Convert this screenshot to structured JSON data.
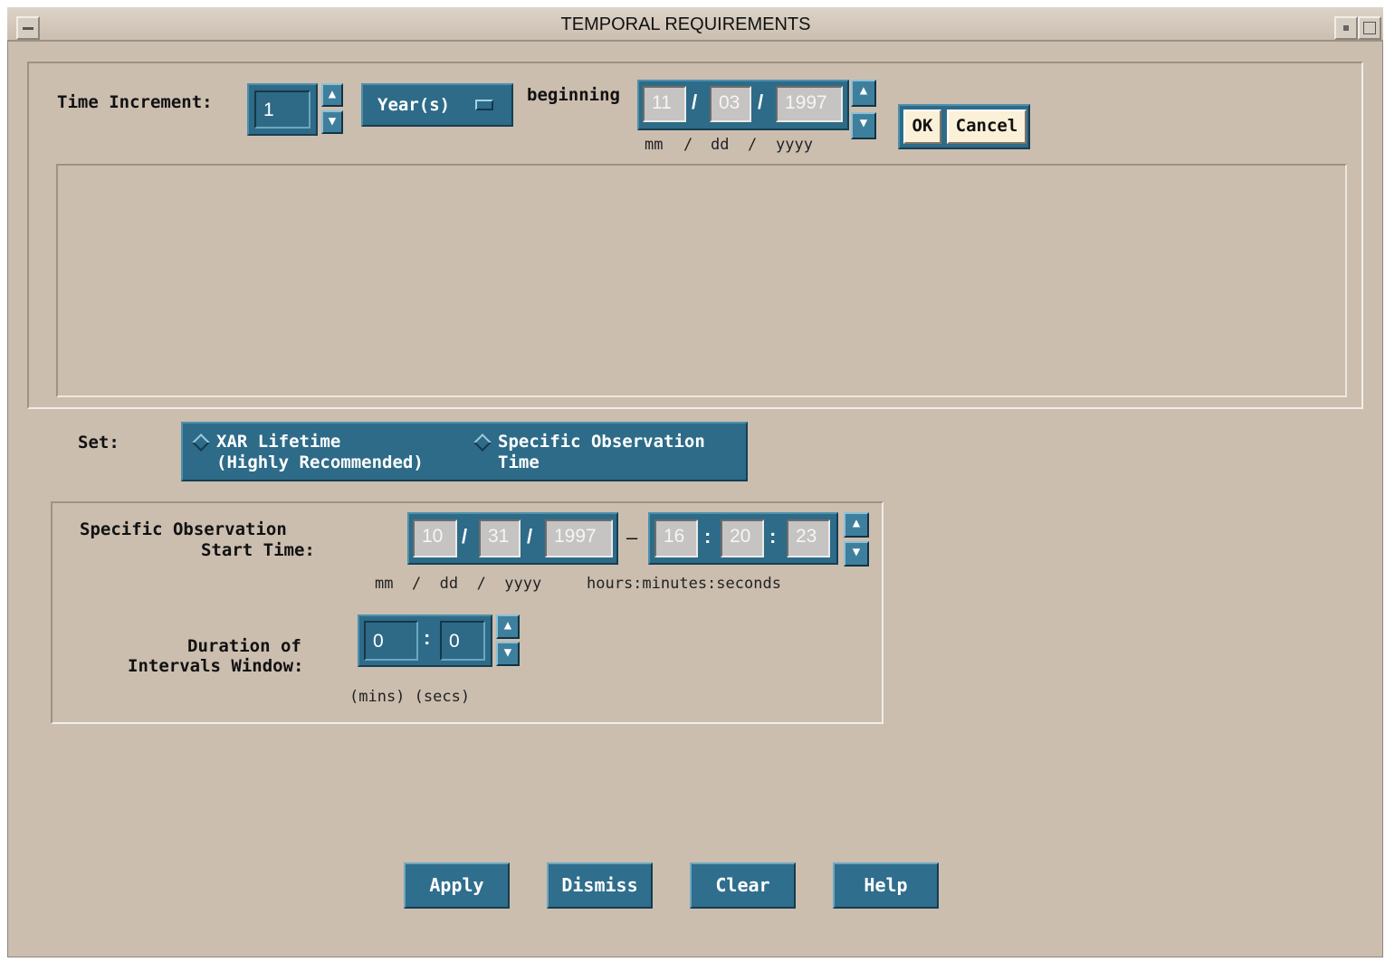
{
  "window": {
    "title": "TEMPORAL REQUIREMENTS"
  },
  "increment": {
    "label": "Time Increment:",
    "value": "1",
    "unit": "Year(s)",
    "beginning_label": "beginning",
    "date": {
      "mm": "11",
      "dd": "03",
      "yyyy": "1997",
      "sep": "/"
    },
    "date_format": {
      "mm": "mm",
      "dd": "dd",
      "yyyy": "yyyy",
      "sep": "/"
    },
    "ok_label": "OK",
    "cancel_label": "Cancel"
  },
  "set": {
    "label": "Set:",
    "options": [
      {
        "line1": "XAR Lifetime",
        "line2": "(Highly Recommended)"
      },
      {
        "line1": "Specific Observation",
        "line2": "Time"
      }
    ]
  },
  "observation": {
    "label_line1": "Specific Observation",
    "label_line2": "Start Time:",
    "date": {
      "mm": "10",
      "dd": "31",
      "yyyy": "1997"
    },
    "date_sep": "/",
    "dash": "–",
    "time": {
      "hours": "16",
      "minutes": "20",
      "seconds": "23"
    },
    "time_sep": ":",
    "date_format": "mm  /  dd  /  yyyy",
    "time_format": "hours:minutes:seconds"
  },
  "duration": {
    "label_line1": "Duration of",
    "label_line2": "Intervals Window:",
    "mins": "0",
    "secs": "0",
    "sep": ":",
    "units": "(mins) (secs)"
  },
  "footer": {
    "apply_label": "Apply",
    "dismiss_label": "Dismiss",
    "clear_label": "Clear",
    "help_label": "Help"
  },
  "icons": {
    "spin_up": "up-arrow-icon",
    "spin_down": "down-arrow-icon",
    "radio": "diamond-radio-icon",
    "menu": "option-menu-icon"
  }
}
